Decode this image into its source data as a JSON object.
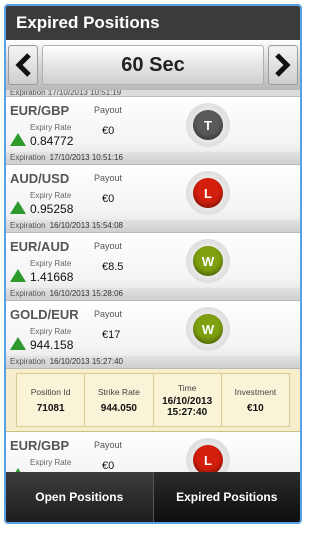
{
  "title": "Expired Positions",
  "selector": {
    "value": "60 Sec"
  },
  "top_cut_text": "Expiration  17/10/2013 10:51:19",
  "positions": [
    {
      "pair": "EUR/GBP",
      "expiry_label": "Expiry Rate",
      "expiry_rate": "0.84772",
      "payout_label": "Payout",
      "payout": "€0",
      "badge": "T",
      "badge_color": "#5a5a5a",
      "expiration_label": "Expiration",
      "expiration": "17/10/2013 10:51:16"
    },
    {
      "pair": "AUD/USD",
      "expiry_label": "Expiry Rate",
      "expiry_rate": "0.95258",
      "payout_label": "Payout",
      "payout": "€0",
      "badge": "L",
      "badge_color": "#d41f0c",
      "expiration_label": "Expiration",
      "expiration": "16/10/2013 15:54:08"
    },
    {
      "pair": "EUR/AUD",
      "expiry_label": "Expiry Rate",
      "expiry_rate": "1.41668",
      "payout_label": "Payout",
      "payout": "€8.5",
      "badge": "W",
      "badge_color": "#7fa10f",
      "expiration_label": "Expiration",
      "expiration": "16/10/2013 15:28:06"
    },
    {
      "pair": "GOLD/EUR",
      "expiry_label": "Expiry Rate",
      "expiry_rate": "944.158",
      "payout_label": "Payout",
      "payout": "€17",
      "badge": "W",
      "badge_color": "#7fa10f",
      "expiration_label": "Expiration",
      "expiration": "16/10/2013 15:27:40"
    }
  ],
  "detail": {
    "position_id_label": "Position Id",
    "position_id": "71081",
    "strike_label": "Strike Rate",
    "strike": "944.050",
    "time_label": "Time",
    "time_date": "16/10/2013",
    "time_clock": "15:27:40",
    "investment_label": "Investment",
    "investment": "€10"
  },
  "last_position": {
    "pair": "EUR/GBP",
    "expiry_label": "Expiry Rate",
    "payout_label": "Payout",
    "payout": "€0",
    "badge": "L",
    "badge_color": "#d41f0c"
  },
  "footer": {
    "open_label": "Open Positions",
    "expired_label": "Expired Positions"
  }
}
